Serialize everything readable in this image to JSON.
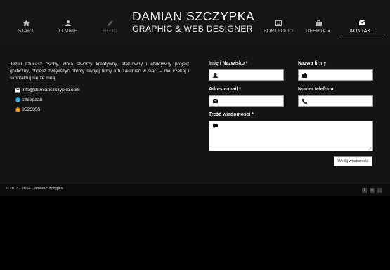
{
  "nav": {
    "items": [
      {
        "label": "START",
        "icon": "home-icon"
      },
      {
        "label": "O MNIE",
        "icon": "user-icon"
      },
      {
        "label": "BLOG",
        "icon": "pencil-icon"
      },
      {
        "label": "PORTFOLIO",
        "icon": "image-icon"
      },
      {
        "label": "OFERTA",
        "icon": "briefcase-icon"
      },
      {
        "label": "KONTAKT",
        "icon": "envelope-icon"
      }
    ]
  },
  "logo": {
    "first": "DAMIAN",
    "last": "SZCZYPKA",
    "tagline": "GRAPHIC & WEB DESIGNER"
  },
  "intro": {
    "text": "Jeżeli szukasz osoby, która stworzy kreatywny, efektowny i efektywny projekt graficzny, chcesz zwiększyć obroty swojej firmy lub zaistnieć w sieci – nie czekaj i skontaktuj się ze mną."
  },
  "contacts": [
    {
      "value": "info@damianszczypka.com",
      "icon": "envelope-icon"
    },
    {
      "value": "sthiepaan",
      "icon": "skype-icon"
    },
    {
      "value": "8525355",
      "icon": "gg-icon"
    }
  ],
  "form": {
    "name_label": "Imię i Nazwisko *",
    "company_label": "Nazwa firmy",
    "email_label": "Adres e-mail *",
    "phone_label": "Numer telefonu",
    "message_label": "Treść wiadomości *",
    "send_label": "Wyślij wiadomość"
  },
  "footer": {
    "copyright": "© 2013 - 2014 Damian Szczypka",
    "social": [
      {
        "glyph": "f",
        "icon": "facebook-icon"
      },
      {
        "glyph": "in",
        "icon": "linkedin-icon"
      },
      {
        "glyph": "",
        "icon": "behance-icon"
      }
    ]
  },
  "colors": {
    "background": "#000000",
    "panel": "#141414",
    "nav": "#161616",
    "text": "#ffffff",
    "muted": "#bdbdbd",
    "disabled": "#5a5a5a"
  }
}
